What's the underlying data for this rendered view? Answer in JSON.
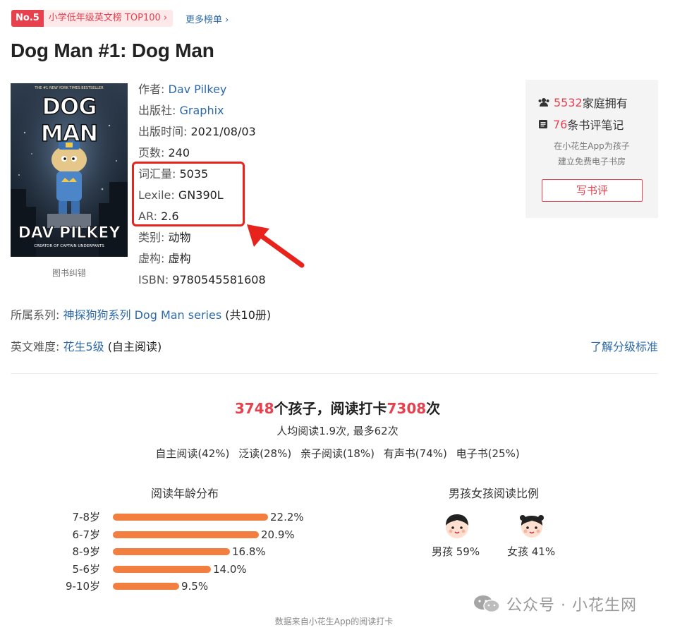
{
  "rank": {
    "no": "No.5",
    "list": "小学低年级英文榜 TOP100 ›",
    "more": "更多榜单 ›"
  },
  "book": {
    "title": "Dog Man #1: Dog Man",
    "cover": {
      "label": "图书纠错",
      "top_text": "THE #1 NEW YORK TIMES BESTSELLER",
      "logo": "DOG MAN",
      "author": "DAV PILKEY",
      "tagline": "CREATOR OF CAPTAIN UNDERPANTS"
    }
  },
  "info": {
    "author": {
      "k": "作者:",
      "v": "Dav Pilkey"
    },
    "publisher": {
      "k": "出版社:",
      "v": "Graphix"
    },
    "date": {
      "k": "出版时间:",
      "v": "2021/08/03"
    },
    "pages": {
      "k": "页数:",
      "v": "240"
    },
    "vocab": {
      "k": "词汇量:",
      "v": "5035"
    },
    "lexile": {
      "k": "Lexile:",
      "v": "GN390L"
    },
    "ar": {
      "k": "AR:",
      "v": "2.6"
    },
    "category": {
      "k": "类别:",
      "v": "动物"
    },
    "fiction": {
      "k": "虚构:",
      "v": "虚构"
    },
    "isbn": {
      "k": "ISBN:",
      "v": "9780545581608"
    }
  },
  "card": {
    "families_num": "5532",
    "families_text": "家庭拥有",
    "notes_num": "76",
    "notes_text": "条书评笔记",
    "hint1": "在小花生App为孩子",
    "hint2": "建立免费电子书房",
    "write_btn": "写书评"
  },
  "series": {
    "k": "所属系列:",
    "v": "神探狗狗系列 Dog Man series",
    "count": "(共10册)"
  },
  "level": {
    "k": "英文难度:",
    "v": "花生5级",
    "mode": "(自主阅读)",
    "link": "了解分级标准"
  },
  "stats": {
    "kids_num": "3748",
    "kids_text": "个孩子，阅读打卡",
    "times_num": "7308",
    "times_text": "次",
    "avg": "人均阅读1.9次, 最多62次",
    "modes": [
      "自主阅读(42%)",
      "泛读(28%)",
      "亲子阅读(18%)",
      "有声书(74%)",
      "电子书(25%)"
    ]
  },
  "age": {
    "title": "阅读年龄分布",
    "rows": [
      {
        "label": "7-8岁",
        "pct": "22.2%",
        "value": 22.2
      },
      {
        "label": "6-7岁",
        "pct": "20.9%",
        "value": 20.9
      },
      {
        "label": "8-9岁",
        "pct": "16.8%",
        "value": 16.8
      },
      {
        "label": "5-6岁",
        "pct": "14.0%",
        "value": 14.0
      },
      {
        "label": "9-10岁",
        "pct": "9.5%",
        "value": 9.5
      }
    ],
    "bar_color": "#f27e3f"
  },
  "gender": {
    "title": "男孩女孩阅读比例",
    "boy": "男孩 59%",
    "girl": "女孩 41%"
  },
  "watermark": "公众号 · 小花生网",
  "source": "数据来自小花生App的阅读打卡",
  "colors": {
    "accent": "#e8414e",
    "link": "#2e6aa8",
    "highlight_box": "#e8231c"
  }
}
